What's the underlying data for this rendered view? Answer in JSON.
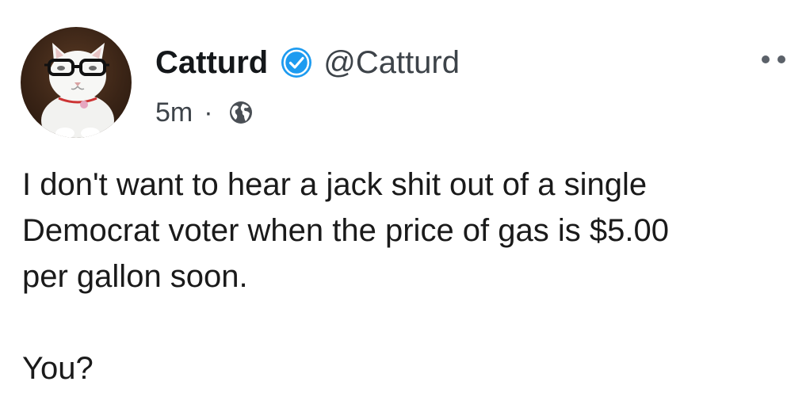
{
  "author": {
    "display_name": "Catturd",
    "handle": "@Catturd",
    "verified": true,
    "avatar_icon": "cat-with-glasses-avatar"
  },
  "meta": {
    "time": "5m",
    "separator": "·",
    "visibility_icon": "globe-icon"
  },
  "tweet": {
    "text_lines": [
      "I don't want to hear a jack shit out of a single",
      "Democrat voter when the price of gas is $5.00",
      "per gallon soon."
    ],
    "second_paragraph": "You?"
  },
  "colors": {
    "verified_badge": "#1d9bf0",
    "text": "#14171a",
    "secondary_text": "#3d4349"
  }
}
